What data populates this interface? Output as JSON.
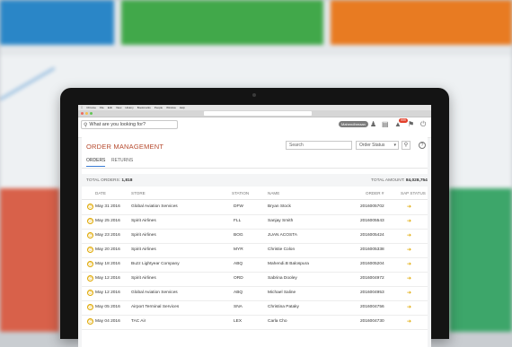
{
  "header": {
    "search_placeholder": "What are you looking for?",
    "user_name": "Mahendhreaan",
    "notification_count": "999"
  },
  "order_management": {
    "title": "ORDER MANAGEMENT",
    "search_placeholder": "Search",
    "status_placeholder": "Order Status",
    "tabs": [
      {
        "label": "ORDERS"
      },
      {
        "label": "RETURNS"
      }
    ],
    "total_orders_label": "TOTAL ORDERS:",
    "total_orders_value": "1,818",
    "total_amount_label": "TOTAL AMOUNT:",
    "total_amount_value": "84,028,754",
    "columns": [
      "DATE",
      "STORE",
      "STATION",
      "NAME",
      "ORDER #",
      "SAP STATUS"
    ],
    "rows": [
      {
        "date": "May 31 2016",
        "store": "Global Aviation Services",
        "station": "DFW",
        "name": "Bryan Stock",
        "order": "2016005702"
      },
      {
        "date": "May 25 2016",
        "store": "Spirit Airlines",
        "station": "FLL",
        "name": "Sanjay Smith",
        "order": "2016005543"
      },
      {
        "date": "May 23 2016",
        "store": "Spirit Airlines",
        "station": "BOG",
        "name": "JUAN ACOSTA",
        "order": "2016005424"
      },
      {
        "date": "May 20 2016",
        "store": "Spirit Airlines",
        "station": "MYR",
        "name": "Christie Colon",
        "order": "2016005338"
      },
      {
        "date": "May 18 2016",
        "store": "Buzz Lightyear Company",
        "station": "ABQ",
        "name": "Mahendi.B Balospura",
        "order": "2016005204"
      },
      {
        "date": "May 12 2016",
        "store": "Spirit Airlines",
        "station": "ORD",
        "name": "Sabrina Dooley",
        "order": "2016004972"
      },
      {
        "date": "May 12 2016",
        "store": "Global Aviation Services",
        "station": "ABQ",
        "name": "Michael Saline",
        "order": "2016004953"
      },
      {
        "date": "May 05 2016",
        "store": "Airport Terminal Services",
        "station": "SNA",
        "name": "Christina Pataky",
        "order": "2016004756"
      },
      {
        "date": "May 04 2016",
        "store": "TAC Air",
        "station": "LEX",
        "name": "Carla Cho",
        "order": "2016004730"
      }
    ]
  },
  "colors": {
    "accent": "#b64a2e",
    "status": "#e0a800",
    "tab_underline": "#3a7bd5"
  }
}
